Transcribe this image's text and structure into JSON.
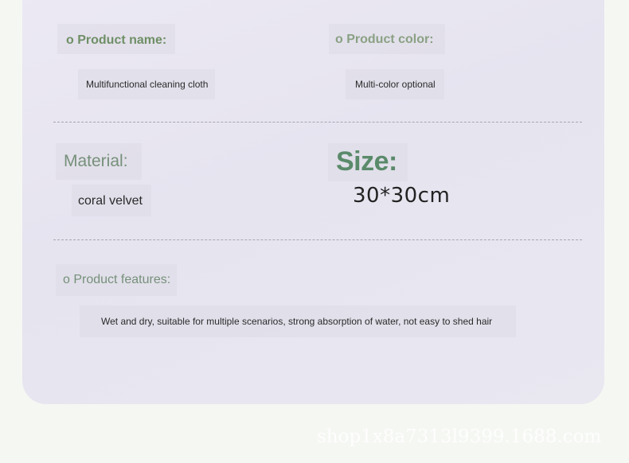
{
  "spec": {
    "product_name_label": "o Product name:",
    "product_name_value": "Multifunctional cleaning cloth",
    "product_color_label": "o Product color:",
    "product_color_value": "Multi-color optional",
    "material_label": "Material:",
    "material_value": "coral velvet",
    "size_label": "Size:",
    "size_value": "30*30cm",
    "features_label": "o Product features:",
    "features_value": "Wet and dry, suitable for multiple scenarios, strong absorption of water, not easy to shed hair"
  },
  "watermark": "shop1x8a7313l9399.1688.com",
  "colors": {
    "label_green": "#6f8f66",
    "size_green": "#5a8a6a",
    "card_bg": "#e9e7f0",
    "page_bg": "#f5f7f3"
  }
}
